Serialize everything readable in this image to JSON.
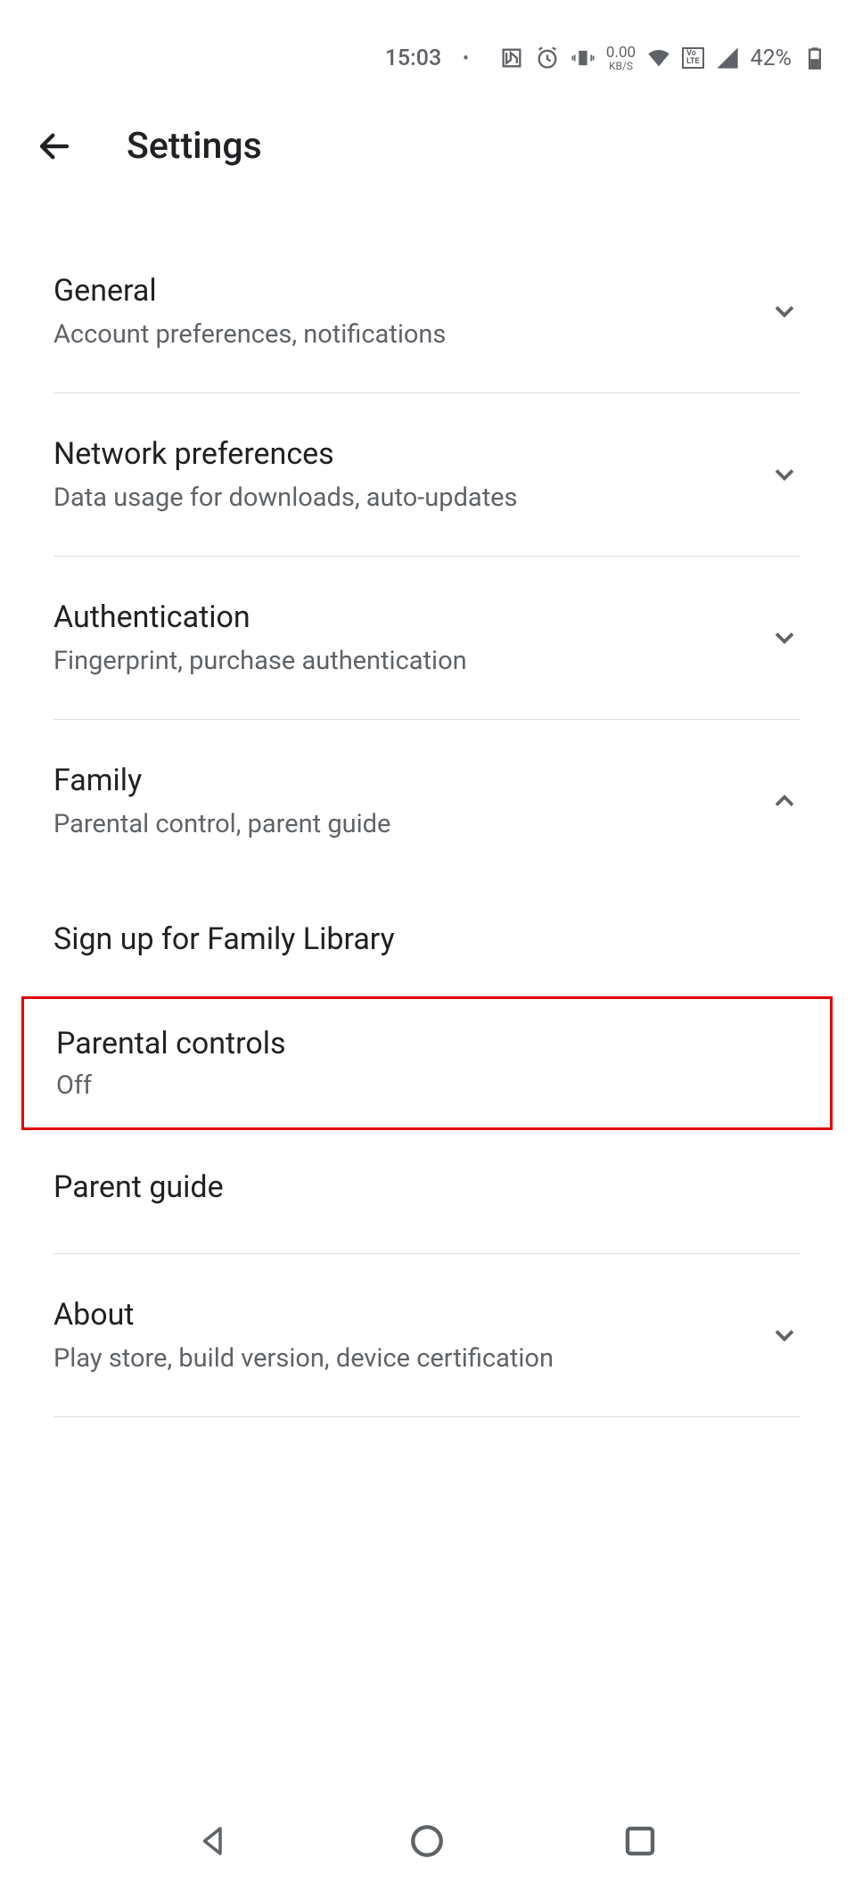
{
  "statusBar": {
    "time": "15:03",
    "netSpeedValue": "0.00",
    "netSpeedUnit": "KB/S",
    "volte": "VoLTE",
    "battery": "42%"
  },
  "header": {
    "title": "Settings"
  },
  "sections": {
    "general": {
      "title": "General",
      "subtitle": "Account preferences, notifications"
    },
    "network": {
      "title": "Network preferences",
      "subtitle": "Data usage for downloads, auto-updates"
    },
    "authentication": {
      "title": "Authentication",
      "subtitle": "Fingerprint, purchase authentication"
    },
    "family": {
      "title": "Family",
      "subtitle": "Parental control, parent guide",
      "subItems": {
        "signup": "Sign up for Family Library",
        "parentalControls": {
          "title": "Parental controls",
          "status": "Off"
        },
        "parentGuide": "Parent guide"
      }
    },
    "about": {
      "title": "About",
      "subtitle": "Play store, build version, device certification"
    }
  }
}
